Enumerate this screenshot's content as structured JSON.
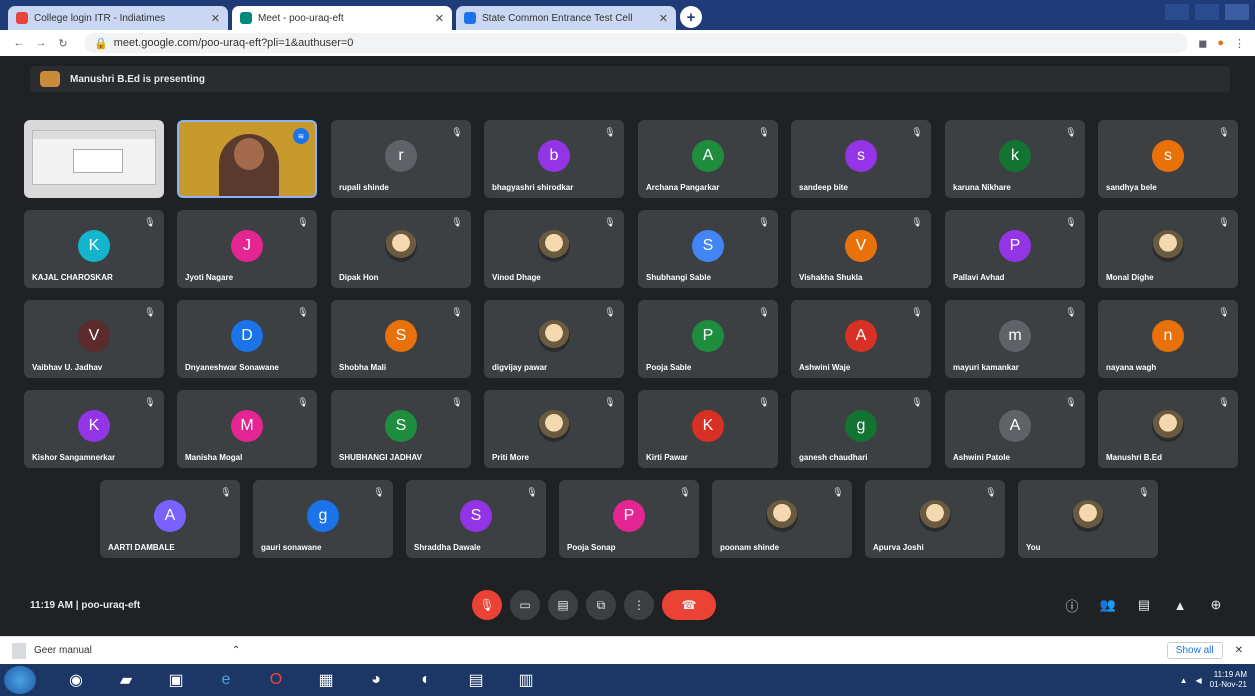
{
  "browser": {
    "tabs": [
      {
        "label": "College login ITR - Indiatimes",
        "fav_color": "#e8453c"
      },
      {
        "label": "Meet - poo-uraq-eft",
        "fav_color": "#00897b",
        "active": true
      },
      {
        "label": "State Common Entrance Test Cell",
        "fav_color": "#1a73e8"
      }
    ],
    "url": "meet.google.com/poo-uraq-eft?pli=1&authuser=0"
  },
  "meet": {
    "presenting_text": "Manushri B.Ed is presenting",
    "meeting_time": "11:19 AM",
    "meeting_code": "poo-uraq-eft",
    "tiles": [
      {
        "name": "",
        "type": "screen"
      },
      {
        "name": "",
        "type": "cam"
      },
      {
        "name": "rupali shinde",
        "letter": "r",
        "color": "#5f6368"
      },
      {
        "name": "bhagyashri shirodkar",
        "letter": "b",
        "color": "#9334e6"
      },
      {
        "name": "Archana Pangarkar",
        "letter": "A",
        "color": "#1e8e3e"
      },
      {
        "name": "sandeep bite",
        "letter": "s",
        "color": "#9334e6"
      },
      {
        "name": "karuna Nikhare",
        "letter": "k",
        "color": "#137333"
      },
      {
        "name": "sandhya bele",
        "letter": "s",
        "color": "#e8710a"
      },
      {
        "name": "KAJAL CHAROSKAR",
        "letter": "K",
        "color": "#12b5cb"
      },
      {
        "name": "Jyoti Nagare",
        "letter": "J",
        "color": "#e52592"
      },
      {
        "name": "Dipak Hon",
        "letter": "",
        "color": "#5f6368",
        "photo": true
      },
      {
        "name": "Vinod Dhage",
        "letter": "",
        "color": "#5f6368",
        "photo": true
      },
      {
        "name": "Shubhangi Sable",
        "letter": "S",
        "color": "#4285f4"
      },
      {
        "name": "Vishakha Shukla",
        "letter": "V",
        "color": "#e8710a"
      },
      {
        "name": "Pallavi Avhad",
        "letter": "P",
        "color": "#9334e6"
      },
      {
        "name": "Monal Dighe",
        "letter": "",
        "color": "#5f6368",
        "photo": true
      },
      {
        "name": "Vaibhav U. Jadhav",
        "letter": "V",
        "color": "#5c2c2c"
      },
      {
        "name": "Dnyaneshwar Sonawane",
        "letter": "D",
        "color": "#1a73e8"
      },
      {
        "name": "Shobha Mali",
        "letter": "S",
        "color": "#e8710a"
      },
      {
        "name": "digvijay pawar",
        "letter": "",
        "color": "#5f6368",
        "photo": true
      },
      {
        "name": "Pooja Sable",
        "letter": "P",
        "color": "#1e8e3e"
      },
      {
        "name": "Ashwini Waje",
        "letter": "A",
        "color": "#d93025"
      },
      {
        "name": "mayuri kamankar",
        "letter": "m",
        "color": "#5f6368"
      },
      {
        "name": "nayana wagh",
        "letter": "n",
        "color": "#e8710a"
      },
      {
        "name": "Kishor Sangamnerkar",
        "letter": "K",
        "color": "#9334e6"
      },
      {
        "name": "Manisha Mogal",
        "letter": "M",
        "color": "#e52592"
      },
      {
        "name": "SHUBHANGI JADHAV",
        "letter": "S",
        "color": "#1e8e3e"
      },
      {
        "name": "Priti More",
        "letter": "",
        "color": "#5f6368",
        "photo": true
      },
      {
        "name": "Kirti Pawar",
        "letter": "K",
        "color": "#d93025"
      },
      {
        "name": "ganesh chaudhari",
        "letter": "g",
        "color": "#137333"
      },
      {
        "name": "Ashwini Patole",
        "letter": "A",
        "color": "#5f6368"
      },
      {
        "name": "Manushri B.Ed",
        "letter": "",
        "color": "#5f6368",
        "photo": true
      }
    ],
    "bottom_row": [
      {
        "name": "AARTI DAMBALE",
        "letter": "A",
        "color": "#7b61ff"
      },
      {
        "name": "gauri sonawane",
        "letter": "g",
        "color": "#1a73e8"
      },
      {
        "name": "Shraddha Dawale",
        "letter": "S",
        "color": "#9334e6"
      },
      {
        "name": "Pooja Sonap",
        "letter": "P",
        "color": "#e52592"
      },
      {
        "name": "poonam shinde",
        "letter": "",
        "color": "#5f6368",
        "photo": true
      },
      {
        "name": "Apurva Joshi",
        "letter": "",
        "color": "#5f6368",
        "photo": true
      },
      {
        "name": "You",
        "letter": "",
        "color": "#5f6368",
        "photo": true
      }
    ]
  },
  "downloads": {
    "file": "Geer manual",
    "show_all": "Show all"
  },
  "taskbar": {
    "time": "11:19 AM",
    "date": "01-Nov-21"
  }
}
